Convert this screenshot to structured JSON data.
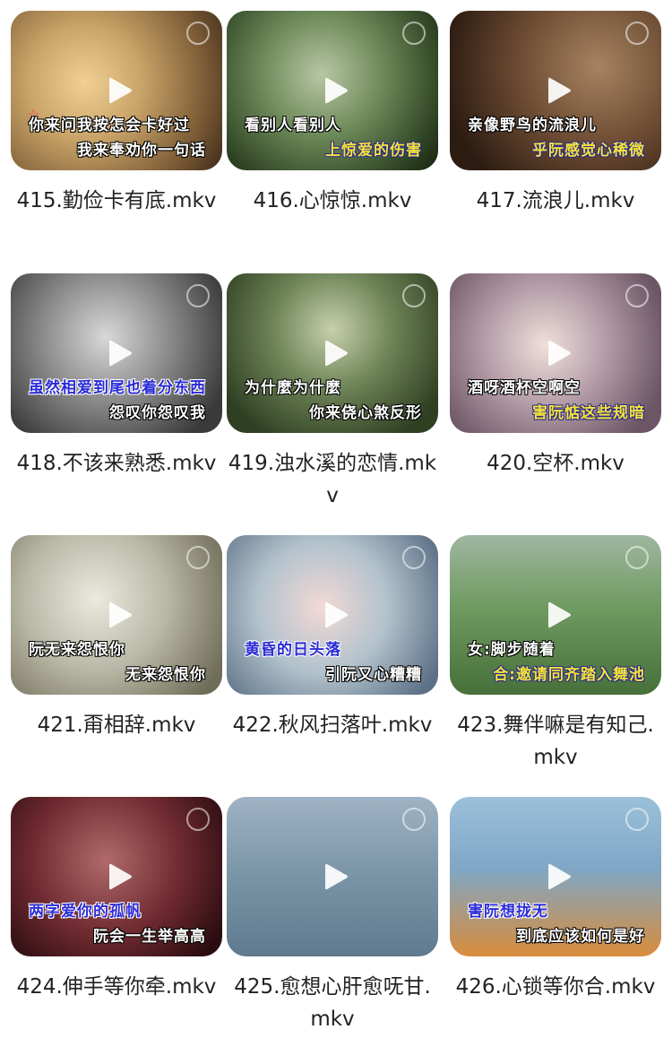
{
  "videos": [
    {
      "title": "415.勤俭卡有底.mkv",
      "sub1": "你来问我按怎会卡好过",
      "sub2": "我来奉劝你一句话",
      "icon": "play-icon"
    },
    {
      "title": "416.心惊惊.mkv",
      "sub1": "看别人看别人",
      "sub2": "上惊爱的伤害",
      "icon": "play-icon"
    },
    {
      "title": "417.流浪儿.mkv",
      "sub1": "亲像野鸟的流浪儿",
      "sub2": "乎阮感觉心稀微",
      "icon": "play-icon"
    },
    {
      "title": "418.不该来熟悉.mkv",
      "sub1": "虽然相爱到尾也着分东西",
      "sub2": "怨叹你怨叹我",
      "icon": "play-icon"
    },
    {
      "title": "419.浊水溪的恋情.mkv",
      "sub1": "为什麼为什麼",
      "sub2": "你来侥心煞反形",
      "icon": "play-icon"
    },
    {
      "title": "420.空杯.mkv",
      "sub1": "酒呀酒杯空啊空",
      "sub2": "害阮惦这些规暗",
      "icon": "play-icon"
    },
    {
      "title": "421.甭相辞.mkv",
      "sub1": "阮无来怨恨你",
      "sub2": "无来怨恨你",
      "icon": "play-icon"
    },
    {
      "title": "422.秋风扫落叶.mkv",
      "sub1": "黄昏的日头落",
      "sub2": "引阮又心糟糟",
      "icon": "play-icon"
    },
    {
      "title": "423.舞伴嘛是有知己.mkv",
      "sub1": "女:脚步随着",
      "sub2": "合:邀请同齐踏入舞池",
      "icon": "play-icon"
    },
    {
      "title": "424.伸手等你牵.mkv",
      "sub1": "两字爱你的孤帆",
      "sub2": "阮会一生举高高",
      "icon": "play-icon"
    },
    {
      "title": "425.愈想心肝愈呒甘.mkv",
      "sub1": "",
      "sub2": "",
      "icon": "play-icon"
    },
    {
      "title": "426.心锁等你合.mkv",
      "sub1": "害阮想拢无",
      "sub2": "到底应该如何是好",
      "icon": "play-icon"
    }
  ]
}
